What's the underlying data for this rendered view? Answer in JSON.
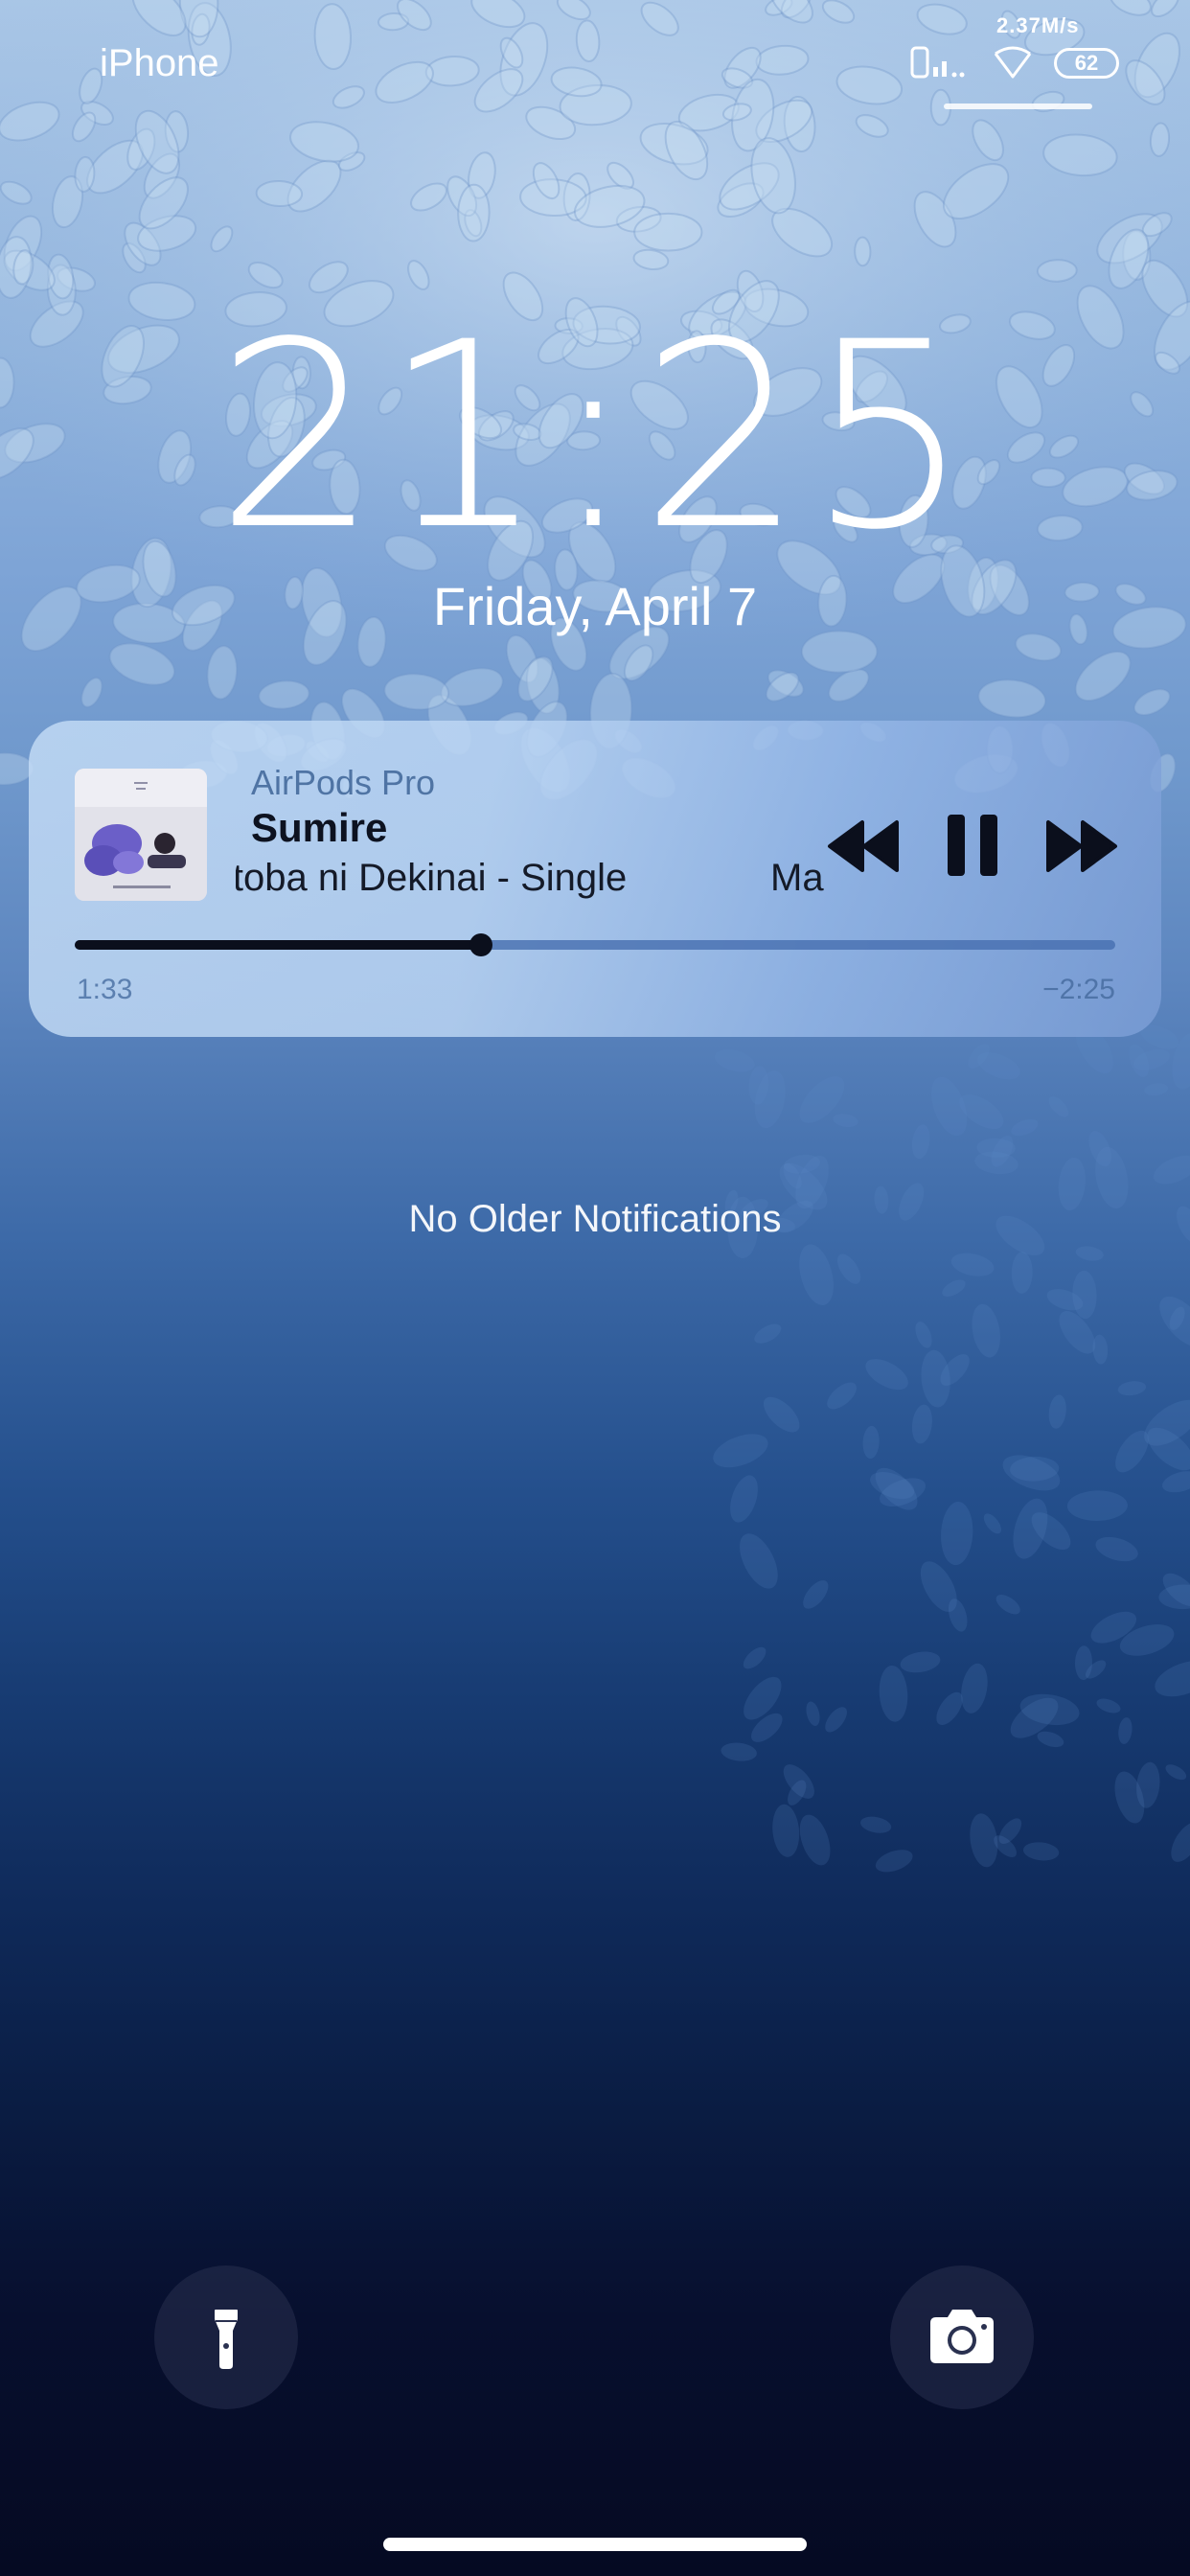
{
  "status_bar": {
    "carrier": "iPhone",
    "net_speed": "2.37M/s",
    "battery": "62",
    "icons": [
      "signal-icon",
      "wifi-icon",
      "battery-icon"
    ]
  },
  "lock": {
    "time": "21:25",
    "date": "Friday, April 7"
  },
  "now_playing": {
    "device": "AirPods Pro",
    "title": "Sumire",
    "subtitle": "Kotoba ni Dekinai - Single",
    "artist": "Ma",
    "elapsed": "1:33",
    "remaining": "−2:25",
    "progress": 0.39,
    "controls": [
      "rewind-icon",
      "pause-icon",
      "fast-forward-icon"
    ],
    "colors": {
      "device_label": "#4f74a4",
      "track_fill": "#0b0f1c",
      "track_rest": "#466eaf"
    }
  },
  "notifications": {
    "empty_label": "No Older Notifications"
  },
  "bottom": {
    "left_icon": "flashlight-icon",
    "right_icon": "camera-icon"
  }
}
